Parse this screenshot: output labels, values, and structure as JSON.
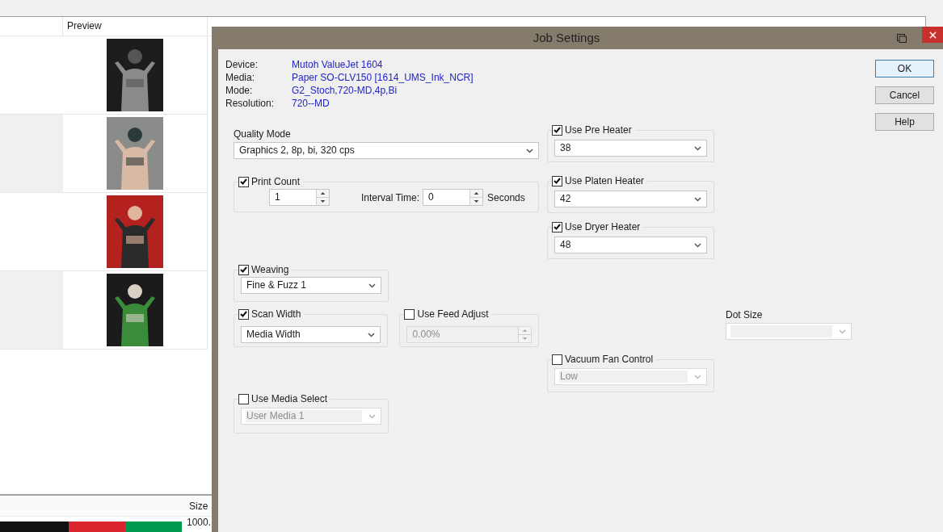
{
  "list": {
    "header": "Preview"
  },
  "bottom_panel": {
    "header": "Size",
    "swatches": [
      {
        "color": "#111111"
      },
      {
        "color": "#d9262e"
      },
      {
        "color": "#009a4e"
      }
    ],
    "size": "1000."
  },
  "dialog": {
    "title": "Job Settings",
    "info": [
      {
        "label": "Device:",
        "value": "Mutoh ValueJet 1604"
      },
      {
        "label": "Media:",
        "value": "Paper SO-CLV150 [1614_UMS_Ink_NCR]"
      },
      {
        "label": "Mode:",
        "value": "G2_Stoch,720-MD,4p,Bi"
      },
      {
        "label": "Resolution:",
        "value": "720--MD"
      }
    ],
    "quality_mode": {
      "label": "Quality Mode",
      "value": "Graphics 2, 8p, bi, 320 cps"
    },
    "print_count": {
      "label": "Print Count",
      "checked": true,
      "count": "1",
      "interval_label": "Interval Time:",
      "interval": "0",
      "unit": "Seconds"
    },
    "heaters": [
      {
        "label": "Use Pre Heater",
        "checked": true,
        "value": "38"
      },
      {
        "label": "Use Platen Heater",
        "checked": true,
        "value": "42"
      },
      {
        "label": "Use Dryer Heater",
        "checked": true,
        "value": "48"
      }
    ],
    "weaving": {
      "label": "Weaving",
      "checked": true,
      "value": "Fine & Fuzz 1"
    },
    "scan_width": {
      "label": "Scan Width",
      "checked": true,
      "value": "Media Width"
    },
    "feed_adjust": {
      "label": "Use Feed Adjust",
      "checked": false,
      "value": "0.00%"
    },
    "vacuum_fan": {
      "label": "Vacuum Fan Control",
      "checked": false,
      "value": "Low"
    },
    "dot_size": {
      "label": "Dot Size",
      "disabled": true
    },
    "media_select": {
      "label": "Use Media Select",
      "checked": false,
      "value": "User Media 1"
    },
    "buttons": [
      {
        "label": "OK",
        "default": true
      },
      {
        "label": "Cancel",
        "default": false
      },
      {
        "label": "Help",
        "default": false
      }
    ]
  }
}
